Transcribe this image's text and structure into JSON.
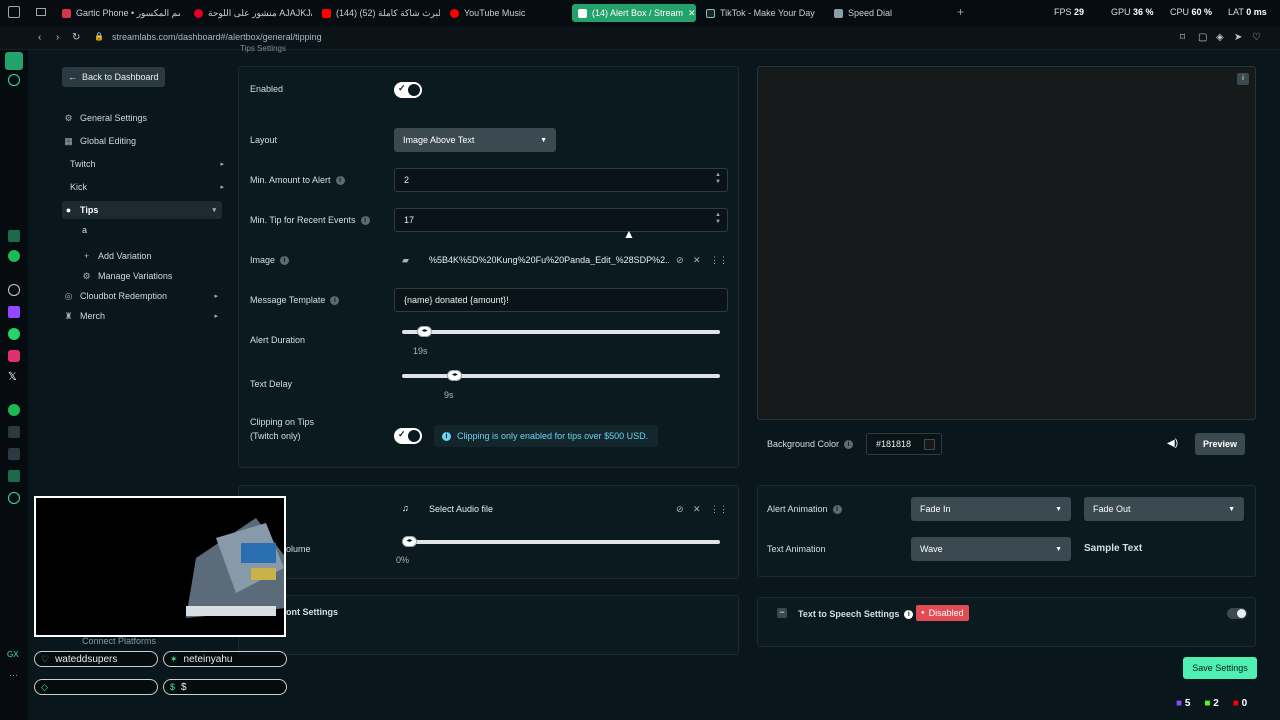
{
  "browser": {
    "tabs": [
      {
        "label": "Gartic Phone • رسم المكسور",
        "color": "#d4344c"
      },
      {
        "label": "منشور على اللوحة AJAJKJA",
        "color": "#e60023"
      },
      {
        "label": "(144) البرث شاكة كاملة (52)",
        "color": "#ff0000"
      },
      {
        "label": "YouTube Music",
        "color": "#ff0000"
      },
      {
        "label": "(14) Alert Box / Stream",
        "color": "#ffffff"
      },
      {
        "label": "TikTok - Make Your Day",
        "color": "#111111"
      },
      {
        "label": "Speed Dial",
        "color": "#8aa0a8"
      }
    ],
    "url": "streamlabs.com/dashboard#/alertbox/general/tipping",
    "stats": {
      "fps_label": "FPS",
      "fps": "29",
      "gpu_label": "GPU",
      "gpu": "36 %",
      "cpu_label": "CPU",
      "cpu": "60 %",
      "lat_label": "LAT",
      "lat": "0 ms"
    }
  },
  "sidebar": {
    "back": "Back to Dashboard",
    "items": [
      {
        "label": "General Settings",
        "icon": "gear-icon"
      },
      {
        "label": "Global Editing",
        "icon": "grid-icon"
      },
      {
        "label": "Twitch",
        "icon": ""
      },
      {
        "label": "Kick",
        "icon": ""
      },
      {
        "label": "Tips",
        "icon": "dollar-icon"
      },
      {
        "label": "a",
        "icon": ""
      },
      {
        "label": "Add Variation",
        "icon": "plus-icon"
      },
      {
        "label": "Manage Variations",
        "icon": "gear-icon"
      },
      {
        "label": "Cloudbot Redemption",
        "icon": "gift-icon"
      },
      {
        "label": "Merch",
        "icon": "shirt-icon"
      }
    ],
    "partial_items": [
      "Connect Platforms"
    ]
  },
  "tips": {
    "header_fragment": "Tips Settings",
    "enabled_label": "Enabled",
    "layout_label": "Layout",
    "layout_value": "Image Above Text",
    "min_amount_label": "Min. Amount to Alert",
    "min_amount_value": "2",
    "min_tip_label": "Min. Tip for Recent Events",
    "min_tip_value": "17",
    "image_label": "Image",
    "image_value": "%5B4K%5D%20Kung%20Fu%20Panda_Edit_%28SDP%2...",
    "message_label": "Message Template",
    "message_value": "{name} donated {amount}!",
    "duration_label": "Alert Duration",
    "duration_value": "19s",
    "duration_fraction": 0.05,
    "delay_label": "Text Delay",
    "delay_value": "9s",
    "delay_fraction": 0.15,
    "clipping_label": "Clipping on Tips",
    "clipping_sublabel": "(Twitch only)",
    "clipping_info": "Clipping is only enabled for tips over $500 USD."
  },
  "audio": {
    "select_label": "Select Audio file",
    "volume_fragment": "olume",
    "volume_value": "0%",
    "volume_fraction": 0.0,
    "font_fragment": "ont Settings"
  },
  "preview": {
    "bg_label": "Background Color",
    "bg_value": "#181818",
    "preview_btn": "Preview"
  },
  "animation": {
    "alert_label": "Alert Animation",
    "alert_in": "Fade In",
    "alert_out": "Fade Out",
    "text_label": "Text Animation",
    "text_value": "Wave",
    "sample_text": "Sample Text"
  },
  "tts": {
    "label": "Text to Speech Settings",
    "status": "Disabled"
  },
  "save_label": "Save Settings",
  "overlay": {
    "chip1": "wateddsupers",
    "chip2": "neteinyahu",
    "chip3": "",
    "chip4": "$"
  },
  "status_counts": {
    "a": "5",
    "b": "2",
    "c": "0"
  },
  "colors": {
    "accent": "#4ff0b2",
    "active_tab": "#23a36b",
    "disabled": "#e04b55"
  }
}
